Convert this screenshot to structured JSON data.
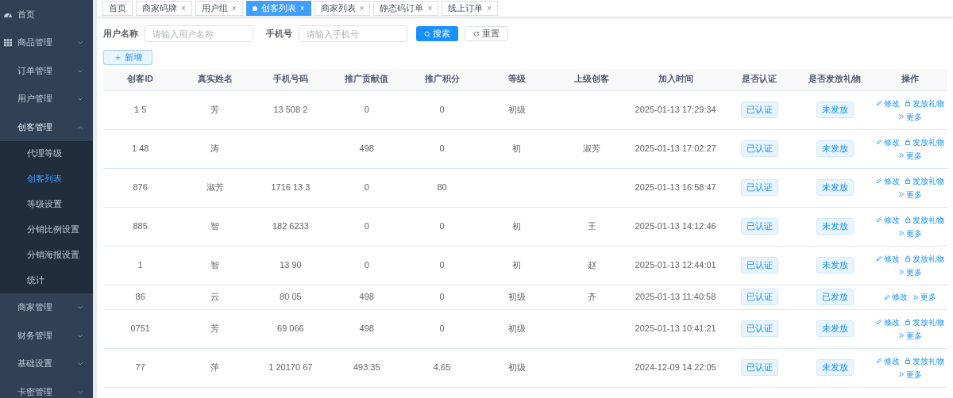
{
  "sidebar": {
    "items": [
      {
        "label": "首页"
      },
      {
        "label": "商品管理",
        "expanded": false
      },
      {
        "label": "订单管理",
        "expanded": false
      },
      {
        "label": "用户管理",
        "expanded": false
      },
      {
        "label": "创客管理",
        "expanded": true,
        "children": [
          {
            "label": "代理等级",
            "selected": false
          },
          {
            "label": "创客列表",
            "selected": true
          },
          {
            "label": "等级设置",
            "selected": false
          },
          {
            "label": "分销比例设置",
            "selected": false
          },
          {
            "label": "分销海报设置",
            "selected": false
          },
          {
            "label": "统计",
            "selected": false
          }
        ]
      },
      {
        "label": "商家管理",
        "expanded": false
      },
      {
        "label": "财务管理",
        "expanded": false
      },
      {
        "label": "基础设置",
        "expanded": false
      },
      {
        "label": "卡密管理",
        "expanded": false
      }
    ]
  },
  "tabs": [
    {
      "label": "首页",
      "selected": false,
      "closable": false
    },
    {
      "label": "商家码牌",
      "selected": false,
      "closable": true
    },
    {
      "label": "用户组",
      "selected": false,
      "closable": true
    },
    {
      "label": "创客列表",
      "selected": true,
      "closable": true
    },
    {
      "label": "商家列表",
      "selected": false,
      "closable": true
    },
    {
      "label": "静态码订单",
      "selected": false,
      "closable": true
    },
    {
      "label": "线上订单",
      "selected": false,
      "closable": true
    }
  ],
  "close_glyph": "×",
  "filters": [
    {
      "label": "用户名称",
      "placeholder": "请输入用户名称"
    },
    {
      "label": "手机号",
      "placeholder": "请输入手机号"
    }
  ],
  "search_button": "搜索",
  "reset_button": "重置",
  "add_button": "＋ 新增",
  "table": {
    "columns": [
      "创客ID",
      "真实姓名",
      "手机号码",
      "推广贡献值",
      "推广积分",
      "等级",
      "上级创客",
      "加入时间",
      "是否认证",
      "是否发放礼物",
      "操作"
    ],
    "rows": [
      {
        "cells": [
          "1 5",
          "芳",
          "13 508 2",
          "0",
          "0",
          "初级",
          "",
          "2025-01-13 17:29:34"
        ],
        "verified": "已认证",
        "gift": "未发放",
        "actions": [
          {
            "kind": "edit",
            "label": "修改"
          },
          {
            "kind": "gift",
            "label": "发放礼物"
          },
          {
            "kind": "more",
            "label": "更多"
          }
        ]
      },
      {
        "cells": [
          "1 48",
          "涛",
          "",
          "498",
          "0",
          "初",
          "淑芳",
          "2025-01-13 17:02:27"
        ],
        "verified": "已认证",
        "gift": "未发放",
        "actions": [
          {
            "kind": "edit",
            "label": "修改"
          },
          {
            "kind": "gift",
            "label": "发放礼物"
          },
          {
            "kind": "more",
            "label": "更多"
          }
        ]
      },
      {
        "cells": [
          "876",
          "淑芳",
          "1716 13 3",
          "0",
          "80",
          "",
          "",
          "2025-01-13 16:58:47"
        ],
        "verified": "已认证",
        "gift": "未发放",
        "actions": [
          {
            "kind": "edit",
            "label": "修改"
          },
          {
            "kind": "gift",
            "label": "发放礼物"
          },
          {
            "kind": "more",
            "label": "更多"
          }
        ]
      },
      {
        "cells": [
          "885",
          "智",
          "182 6233",
          "0",
          "0",
          "初",
          "王",
          "2025-01-13 14:12:46"
        ],
        "verified": "已认证",
        "gift": "未发放",
        "actions": [
          {
            "kind": "edit",
            "label": "修改"
          },
          {
            "kind": "gift",
            "label": "发放礼物"
          },
          {
            "kind": "more",
            "label": "更多"
          }
        ]
      },
      {
        "cells": [
          "1",
          "智",
          "13 90",
          "0",
          "0",
          "初",
          "赵",
          "2025-01-13 12:44:01"
        ],
        "verified": "已认证",
        "gift": "未发放",
        "actions": [
          {
            "kind": "edit",
            "label": "修改"
          },
          {
            "kind": "gift",
            "label": "发放礼物"
          },
          {
            "kind": "more",
            "label": "更多"
          }
        ]
      },
      {
        "cells": [
          "86",
          "云",
          "80 05",
          "498",
          "0",
          "初级",
          "齐",
          "2025-01-13 11:40:58"
        ],
        "verified": "已认证",
        "gift": "已发放",
        "actions": [
          {
            "kind": "edit",
            "label": "修改"
          },
          {
            "kind": "more",
            "label": "更多"
          }
        ]
      },
      {
        "cells": [
          "0751",
          "芳",
          "69 066",
          "498",
          "0",
          "初级",
          "",
          "2025-01-13 10:41:21"
        ],
        "verified": "已认证",
        "gift": "未发放",
        "actions": [
          {
            "kind": "edit",
            "label": "修改"
          },
          {
            "kind": "gift",
            "label": "发放礼物"
          },
          {
            "kind": "more",
            "label": "更多"
          }
        ]
      },
      {
        "cells": [
          "77",
          "萍",
          "1 20170 67",
          "493.35",
          "4.65",
          "初级",
          "",
          "2024-12-09 14:22:05"
        ],
        "verified": "已认证",
        "gift": "未发放",
        "actions": [
          {
            "kind": "edit",
            "label": "修改"
          },
          {
            "kind": "gift",
            "label": "发放礼物"
          },
          {
            "kind": "more",
            "label": "更多"
          }
        ]
      }
    ]
  }
}
